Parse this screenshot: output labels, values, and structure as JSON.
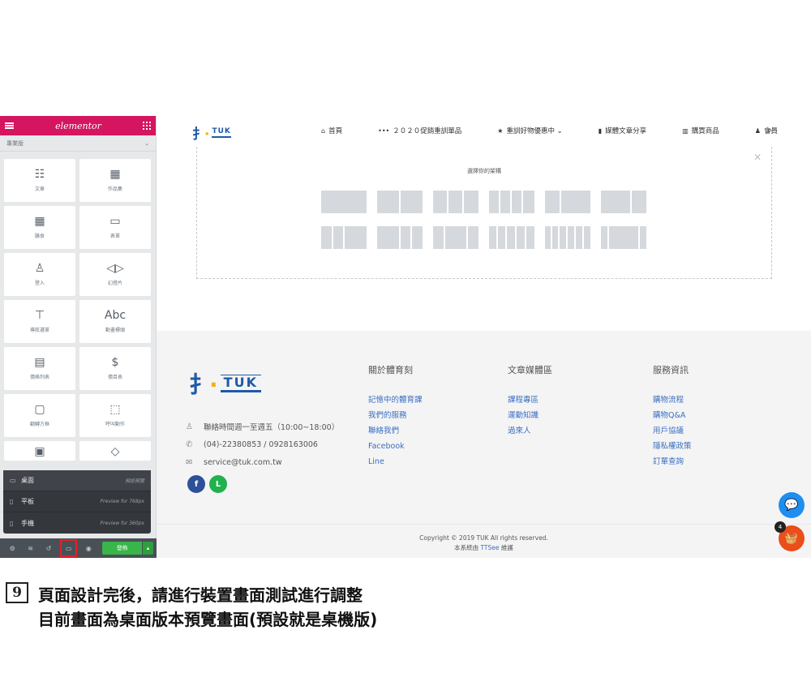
{
  "panel": {
    "logo": "elementor",
    "category": "專業版",
    "widgets": [
      {
        "icon": "☷",
        "label": "文章"
      },
      {
        "icon": "▦",
        "label": "作品集"
      },
      {
        "icon": "▦",
        "label": "膳食"
      },
      {
        "icon": "▭",
        "label": "表單"
      },
      {
        "icon": "♙",
        "label": "登入"
      },
      {
        "icon": "◁▷",
        "label": "幻燈片"
      },
      {
        "icon": "⊤",
        "label": "導航選單"
      },
      {
        "icon": "Abc",
        "label": "動畫標頭"
      },
      {
        "icon": "▤",
        "label": "價格列表"
      },
      {
        "icon": "$",
        "label": "價目表"
      },
      {
        "icon": "▢",
        "label": "翻轉方框"
      },
      {
        "icon": "⬚",
        "label": "呼叫動作"
      },
      {
        "icon": "▣",
        "label": ""
      },
      {
        "icon": "◇",
        "label": ""
      }
    ],
    "responsive": [
      {
        "icon": "▭",
        "label": "桌面",
        "desc": "預設預覽"
      },
      {
        "icon": "▯",
        "label": "平板",
        "desc": "Preview for 768px"
      },
      {
        "icon": "▯",
        "label": "手機",
        "desc": "Preview for 360px"
      }
    ],
    "publish_label": "發佈"
  },
  "site": {
    "brand_mark": "扌",
    "brand_name": "TUK",
    "menu": [
      {
        "icon": "⌂",
        "label": "首頁"
      },
      {
        "icon": "•••",
        "label": "２０２０促銷重訓單品"
      },
      {
        "icon": "★",
        "label": "重訓好物優惠中 ⌄"
      },
      {
        "icon": "▮",
        "label": "媒體文章分享"
      },
      {
        "icon": "▥",
        "label": "購買商品"
      },
      {
        "icon": "♟",
        "label": "會員"
      }
    ],
    "dropzone_title": "選擇你的架構",
    "footer": {
      "contact": [
        {
          "icon": "♙",
          "text": "聯絡時間週一至週五（10:00~18:00）"
        },
        {
          "icon": "✆",
          "text": "(04)-22380853 / 0928163006"
        },
        {
          "icon": "✉",
          "text": "service@tuk.com.tw"
        }
      ],
      "columns": [
        {
          "title": "關於體育刻",
          "links": [
            "記憶中的體育課",
            "我們的服務",
            "聯絡我們",
            "Facebook",
            "Line"
          ]
        },
        {
          "title": "文章媒體區",
          "links": [
            "課程專區",
            "運動知識",
            "過來人"
          ]
        },
        {
          "title": "服務資訊",
          "links": [
            "購物流程",
            "購物Q&A",
            "用戶協議",
            "隱私權政策",
            "訂單查詢"
          ]
        }
      ],
      "copyright": "Copyright © 2019 TUK All rights reserved.",
      "maintained_prefix": "本系統由",
      "maintained_link": "TTSee",
      "maintained_suffix": "維護"
    },
    "cart_count": "4"
  },
  "caption": {
    "step": "9",
    "line1": "頁面設計完後，請進行裝置畫面測試進行調整",
    "line2": "目前畫面為桌面版本預覽畫面(預設就是桌機版)"
  }
}
